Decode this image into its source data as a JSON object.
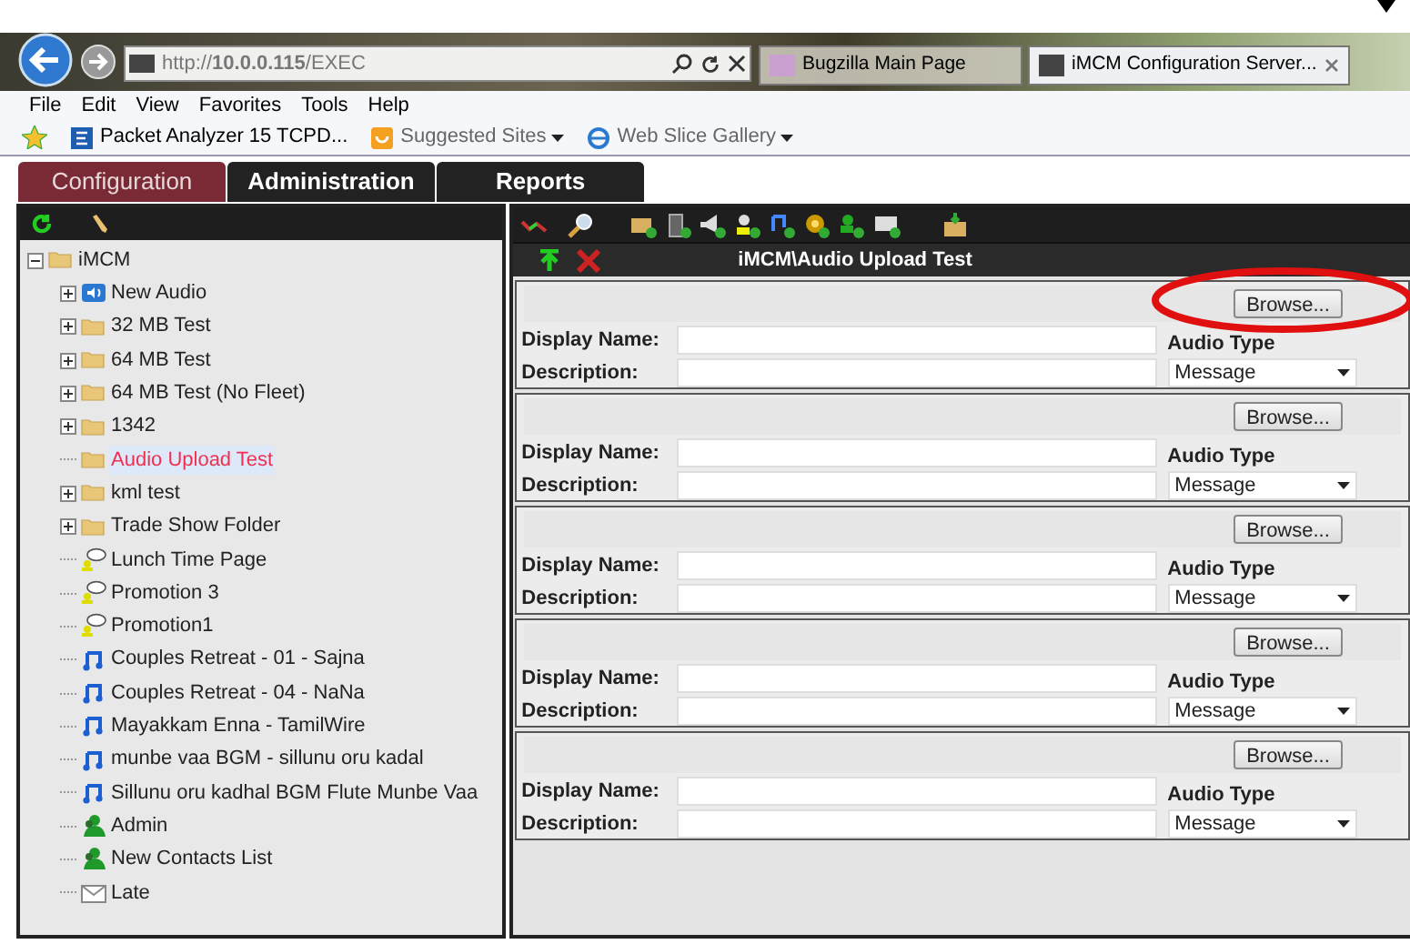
{
  "browser": {
    "address": "http://**10.0.0.115**/EXEC",
    "tabs": [
      {
        "label": "Bugzilla Main Page",
        "selected": false
      },
      {
        "label": "iMCM Configuration Server...",
        "selected": true
      }
    ],
    "menu": [
      "File",
      "Edit",
      "View",
      "Favorites",
      "Tools",
      "Help"
    ],
    "favorites": [
      {
        "label": "Packet Analyzer 15 TCPD...",
        "dropdown": false
      },
      {
        "label": "Suggested Sites",
        "dropdown": true
      },
      {
        "label": "Web Slice Gallery",
        "dropdown": true
      }
    ]
  },
  "app_tabs": [
    {
      "label": "Configuration",
      "selected": true
    },
    {
      "label": "Administration",
      "selected": false
    },
    {
      "label": "Reports",
      "selected": false
    }
  ],
  "tree": [
    {
      "label": "iMCM",
      "kind": "folder",
      "expanded": true,
      "selected": false,
      "children": [
        {
          "label": "New Audio",
          "kind": "audio-folder",
          "expanded": false,
          "selected": false
        },
        {
          "label": "32 MB Test",
          "kind": "folder",
          "expanded": false,
          "selected": false
        },
        {
          "label": "64 MB Test",
          "kind": "folder",
          "expanded": false,
          "selected": false
        },
        {
          "label": "64 MB Test (No Fleet)",
          "kind": "folder",
          "expanded": false,
          "selected": false
        },
        {
          "label": "1342",
          "kind": "folder",
          "expanded": false,
          "selected": false
        },
        {
          "label": "Audio Upload Test",
          "kind": "folder",
          "selected": true
        },
        {
          "label": "kml test",
          "kind": "folder",
          "expanded": false,
          "selected": false
        },
        {
          "label": "Trade Show Folder",
          "kind": "folder",
          "expanded": false,
          "selected": false
        },
        {
          "label": "Lunch Time Page",
          "kind": "promotion",
          "selected": false
        },
        {
          "label": "Promotion 3",
          "kind": "promotion",
          "selected": false
        },
        {
          "label": "Promotion1",
          "kind": "promotion",
          "selected": false
        },
        {
          "label": "Couples Retreat - 01 - Sajna",
          "kind": "audio",
          "selected": false
        },
        {
          "label": "Couples Retreat - 04 - NaNa",
          "kind": "audio",
          "selected": false
        },
        {
          "label": "Mayakkam Enna - TamilWire",
          "kind": "audio",
          "selected": false
        },
        {
          "label": "munbe vaa BGM - sillunu oru kadal",
          "kind": "audio",
          "selected": false
        },
        {
          "label": "Sillunu oru kadhal BGM Flute Munbe Vaa",
          "kind": "audio",
          "selected": false
        },
        {
          "label": "Admin",
          "kind": "contact",
          "selected": false
        },
        {
          "label": "New Contacts List",
          "kind": "contact",
          "selected": false
        },
        {
          "label": "Late",
          "kind": "message",
          "selected": false
        }
      ]
    }
  ],
  "panel_title": "iMCM\\Audio Upload Test",
  "uploads": [
    {
      "browse": "Browse...",
      "display_name_label": "Display Name:",
      "description_label": "Description:",
      "audio_type_label": "Audio Type",
      "audio_type": "Message",
      "highlighted": true
    },
    {
      "browse": "Browse...",
      "display_name_label": "Display Name:",
      "description_label": "Description:",
      "audio_type_label": "Audio Type",
      "audio_type": "Message",
      "highlighted": false
    },
    {
      "browse": "Browse...",
      "display_name_label": "Display Name:",
      "description_label": "Description:",
      "audio_type_label": "Audio Type",
      "audio_type": "Message",
      "highlighted": false
    },
    {
      "browse": "Browse...",
      "display_name_label": "Display Name:",
      "description_label": "Description:",
      "audio_type_label": "Audio Type",
      "audio_type": "Message",
      "highlighted": false
    },
    {
      "browse": "Browse...",
      "display_name_label": "Display Name:",
      "description_label": "Description:",
      "audio_type_label": "Audio Type",
      "audio_type": "Message",
      "highlighted": false
    }
  ]
}
